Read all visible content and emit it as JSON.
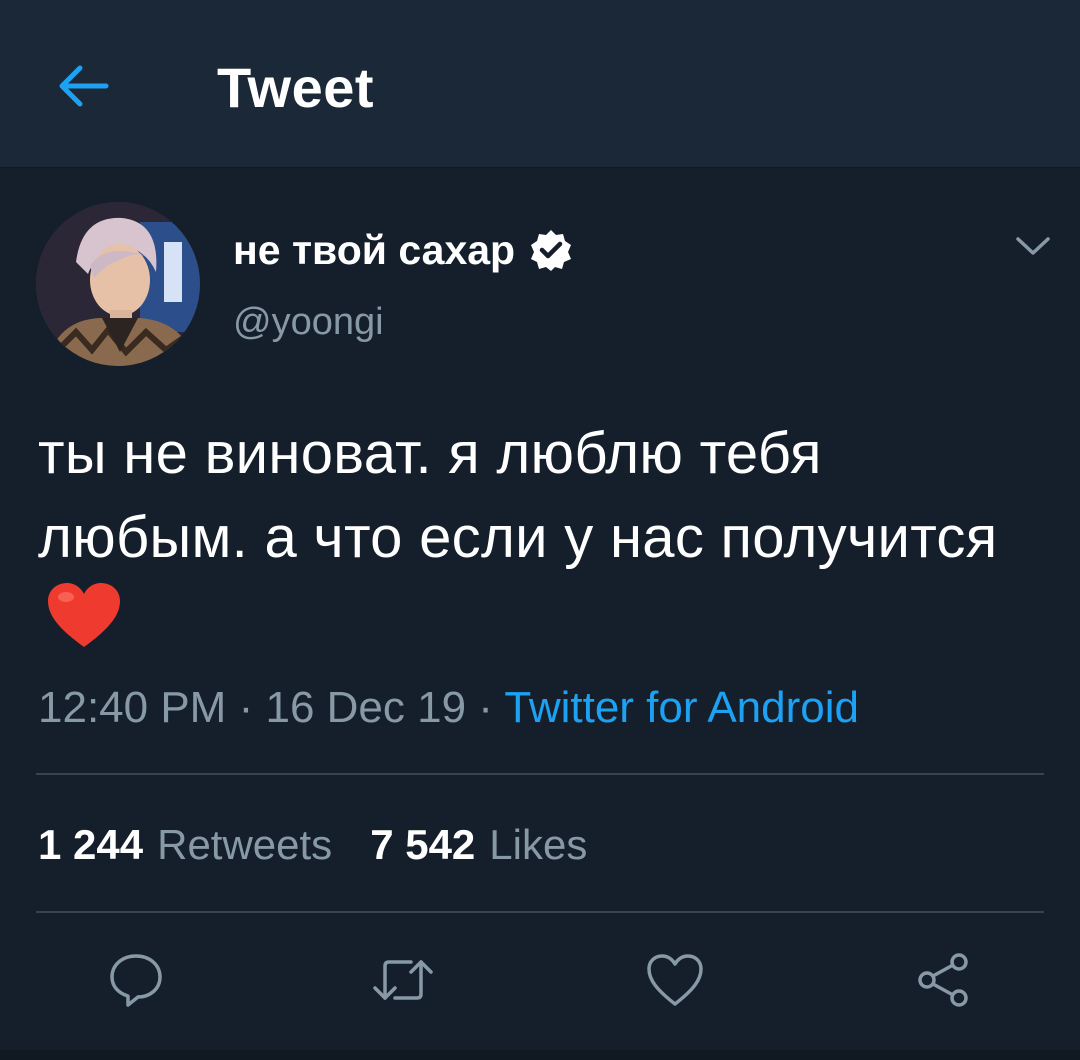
{
  "header": {
    "title": "Tweet",
    "back_icon": "arrow-left-icon",
    "accent_color": "#1da1f2"
  },
  "tweet": {
    "author": {
      "display_name": "не твой сахар",
      "username": "@yoongi",
      "verified": true
    },
    "text": "ты не виноват. я люблю тебя любым. а что если у нас получится",
    "emoji": "red-heart",
    "time": "12:40 PM",
    "date": "16 Dec 19",
    "separator": "·",
    "source": "Twitter for Android"
  },
  "stats": {
    "retweets": {
      "count": "1 244",
      "label": "Retweets"
    },
    "likes": {
      "count": "7 542",
      "label": "Likes"
    }
  },
  "actions": [
    "reply-icon",
    "retweet-icon",
    "like-icon",
    "share-icon"
  ],
  "colors": {
    "background": "#151f2c",
    "header_background": "#1b2837",
    "secondary_text": "#8899a6",
    "link": "#1da1f2",
    "divider": "#38444d"
  }
}
